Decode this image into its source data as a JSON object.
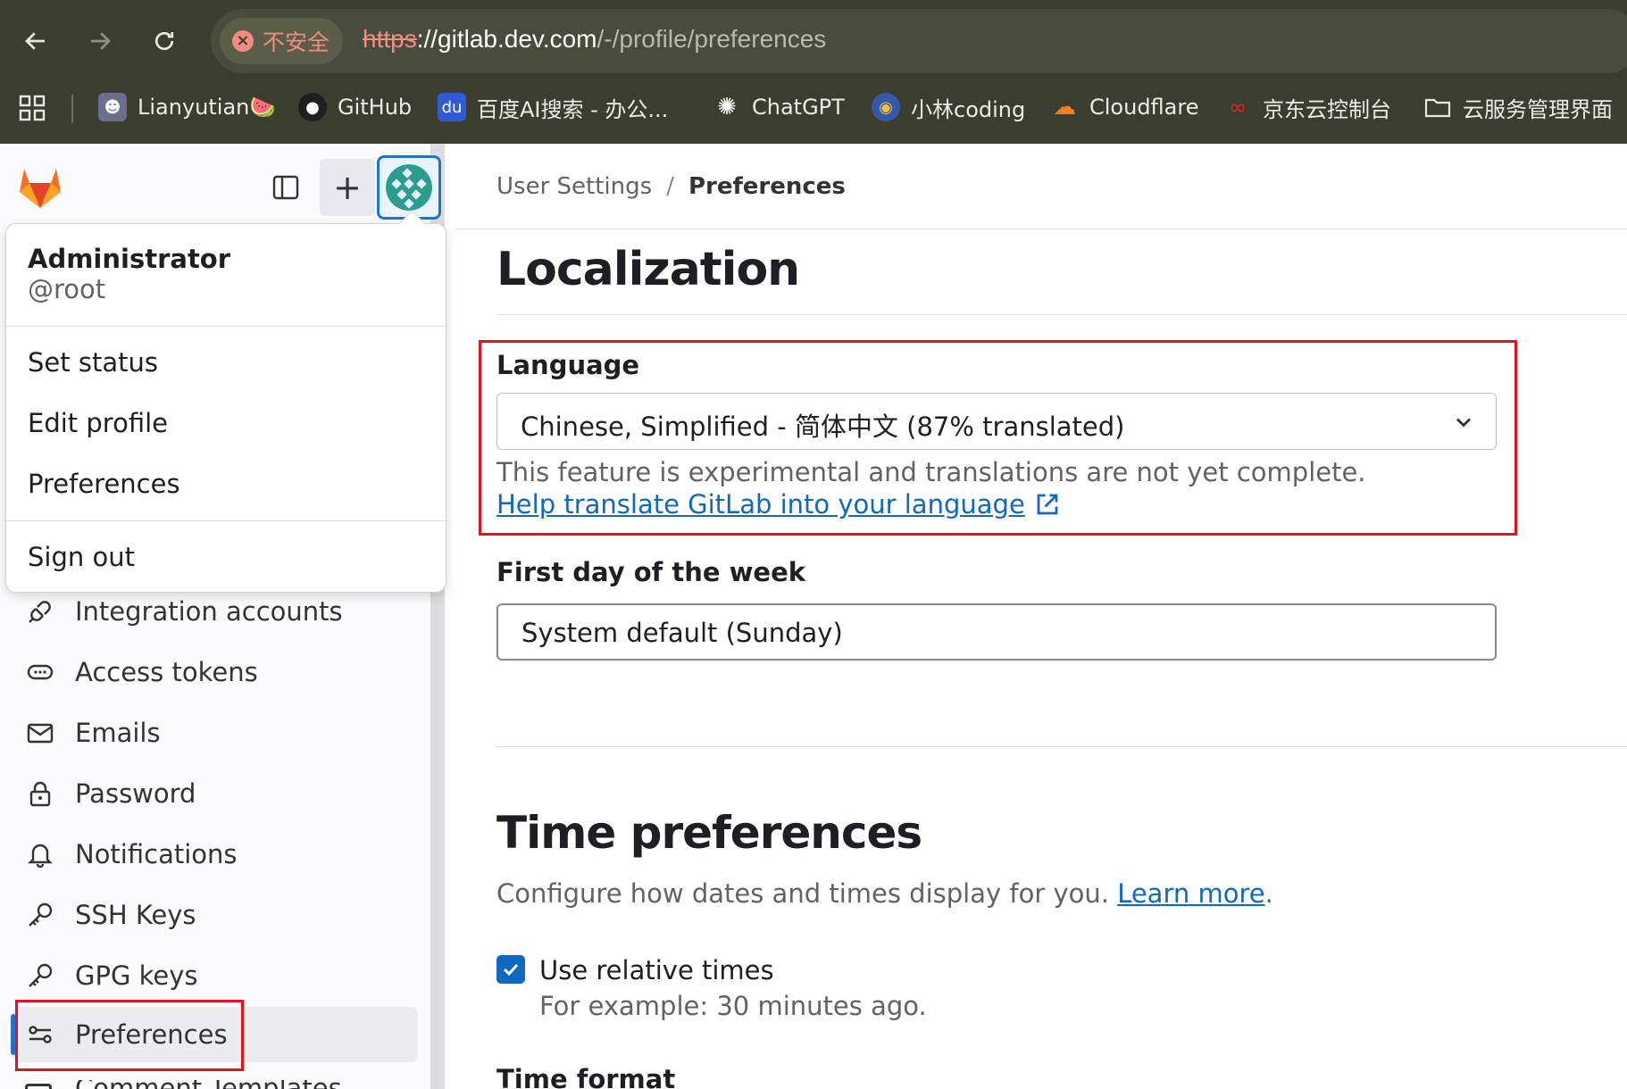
{
  "browser": {
    "security_label": "不安全",
    "url_scheme": "https",
    "url_host": "://gitlab.dev.com",
    "url_path": "/-/profile/preferences",
    "bookmarks": [
      {
        "label": "Lianyutian🍉",
        "icon": "user-avatar-icon"
      },
      {
        "label": "GitHub",
        "icon": "github-icon"
      },
      {
        "label": "百度AI搜索 - 办公...",
        "icon": "baidu-icon"
      },
      {
        "label": "ChatGPT",
        "icon": "openai-icon"
      },
      {
        "label": "小林coding",
        "icon": "xiaolin-icon"
      },
      {
        "label": "Cloudflare",
        "icon": "cloudflare-icon"
      },
      {
        "label": "京东云控制台",
        "icon": "jdcloud-icon"
      },
      {
        "label": "云服务管理界面",
        "icon": "folder-icon"
      }
    ]
  },
  "user_menu": {
    "name": "Administrator",
    "username": "@root",
    "items": [
      "Set status",
      "Edit profile",
      "Preferences",
      "Sign out"
    ]
  },
  "sidebar": {
    "items": [
      {
        "label": "Integration accounts",
        "icon": "plug-icon"
      },
      {
        "label": "Access tokens",
        "icon": "token-icon"
      },
      {
        "label": "Emails",
        "icon": "mail-icon"
      },
      {
        "label": "Password",
        "icon": "lock-icon"
      },
      {
        "label": "Notifications",
        "icon": "bell-icon"
      },
      {
        "label": "SSH Keys",
        "icon": "key-icon"
      },
      {
        "label": "GPG keys",
        "icon": "key-icon"
      },
      {
        "label": "Preferences",
        "icon": "preferences-icon",
        "active": true
      },
      {
        "label": "Comment Templates",
        "icon": "comment-icon"
      }
    ]
  },
  "breadcrumb": {
    "parent": "User Settings",
    "separator": "/",
    "current": "Preferences"
  },
  "localization": {
    "title": "Localization",
    "language_label": "Language",
    "language_value": "Chinese, Simplified - 简体中文 (87% translated)",
    "language_help": "This feature is experimental and translations are not yet complete.",
    "language_link": "Help translate GitLab into your language",
    "first_day_label": "First day of the week",
    "first_day_value": "System default (Sunday)"
  },
  "time_preferences": {
    "title": "Time preferences",
    "description": "Configure how dates and times display for you.",
    "learn_more": "Learn more",
    "description_end": ".",
    "relative_times_label": "Use relative times",
    "relative_times_checked": true,
    "relative_times_help": "For example: 30 minutes ago.",
    "time_format_label": "Time format"
  },
  "colors": {
    "accent": "#1068bf",
    "highlight": "#e1141d",
    "chrome": "#3b3d2f"
  }
}
